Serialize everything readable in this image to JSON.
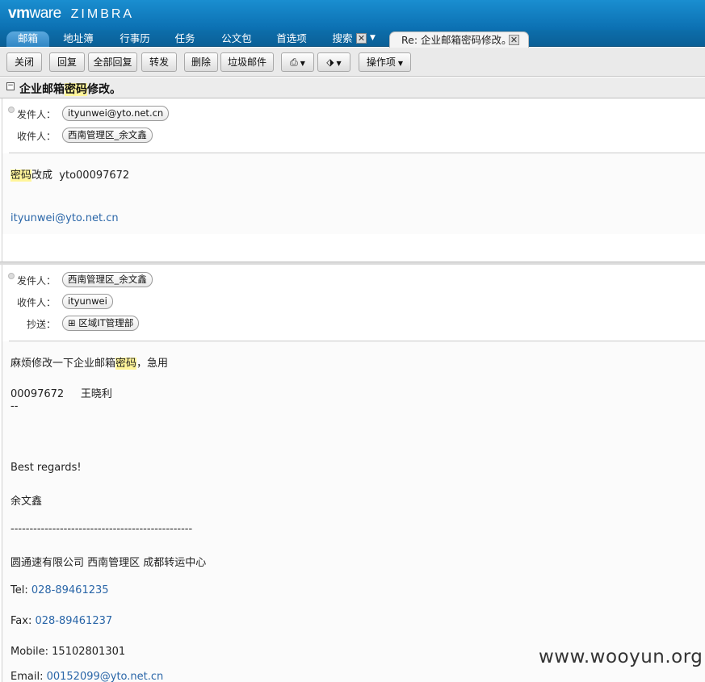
{
  "brand": {
    "vm": "vm",
    "ware": "ware",
    "zimbra": "ZIMBRA"
  },
  "app_tabs": [
    {
      "label": "邮箱"
    },
    {
      "label": "地址簿"
    },
    {
      "label": "行事历"
    },
    {
      "label": "任务"
    },
    {
      "label": "公文包"
    },
    {
      "label": "首选项"
    },
    {
      "label": "搜索"
    }
  ],
  "doc_tab": {
    "label": "Re: 企业邮箱密码修改。"
  },
  "toolbar": {
    "close": "关闭",
    "reply": "回复",
    "reply_all": "全部回复",
    "forward": "转发",
    "delete": "删除",
    "spam": "垃圾邮件",
    "actions": "操作项"
  },
  "conversation": {
    "subject_pre": "企业邮箱",
    "subject_hl": "密码",
    "subject_post": "修改。"
  },
  "message1": {
    "from_label": "发件人：",
    "from": "ityunwei@yto.net.cn",
    "to_label": "收件人：",
    "to": "西南管理区_余文鑫",
    "body_hl": "密码",
    "body_rest": "改成  yto00097672",
    "signature_link": "ityunwei@yto.net.cn"
  },
  "message2": {
    "from_label": "发件人：",
    "from": "西南管理区_余文鑫",
    "to_label": "收件人：",
    "to": "ityunwei",
    "cc_label": "抄送：",
    "cc": "区域IT管理部",
    "line1_pre": "麻烦修改一下企业邮箱",
    "line1_hl": "密码",
    "line1_post": "，急用",
    "line2": "00097672     王晓利",
    "line3": "--",
    "regards": "Best regards!",
    "name": "余文鑫",
    "dashes": "------------------------------------------------",
    "company": "圆通速有限公司 西南管理区 成都转运中心",
    "tel_label": "Tel: ",
    "tel": "028-89461235",
    "fax_label": "Fax: ",
    "fax": "028-89461237",
    "mobile": "Mobile: 15102801301",
    "email_label": "Email: ",
    "email": "00152099@yto.net.cn"
  },
  "watermark": "www.wooyun.org",
  "colors": {
    "header_blue": "#0b6fb1",
    "link": "#2a66a8",
    "highlight": "#fff59a"
  }
}
